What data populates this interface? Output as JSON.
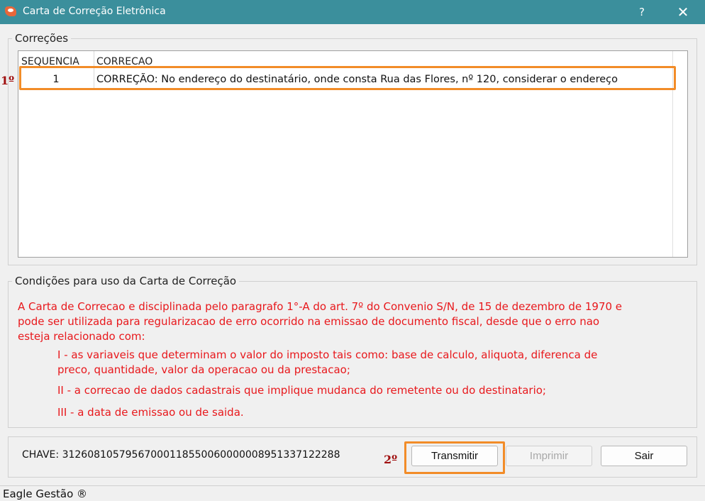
{
  "window": {
    "title": "Carta de Correção Eletrônica",
    "help": "?",
    "close": "✕"
  },
  "corrections": {
    "group_title": "Correções",
    "columns": [
      "SEQUENCIA",
      "CORRECAO"
    ],
    "rows": [
      {
        "seq": "1",
        "correcao": "CORREÇÃO: No endereço do destinatário, onde consta Rua das Flores, nº 120, considerar o endereço"
      }
    ]
  },
  "conditions": {
    "group_title": "Condições para uso da Carta de Correção",
    "intro_lines": [
      "A Carta de Correcao e disciplinada pelo paragrafo 1°-A do art. 7º do Convenio S/N, de 15 de dezembro de 1970 e",
      "pode ser utilizada para regularizacao de erro ocorrido na emissao de documento fiscal, desde que o erro nao",
      "esteja relacionado com:"
    ],
    "item1_lines": [
      "I - as variaveis que determinam o valor do imposto tais como: base de calculo, aliquota, diferenca de",
      "preco, quantidade, valor da operacao ou da prestacao;"
    ],
    "item2": "II - a correcao de dados cadastrais que implique mudanca do remetente ou do destinatario;",
    "item3": "III - a data de emissao ou de saida."
  },
  "footer": {
    "chave": "CHAVE: 31260810579567000118550060000008951337122288",
    "transmitir": "Transmitir",
    "imprimir": "Imprimir",
    "sair": "Sair"
  },
  "markers": {
    "first": "1º",
    "second": "2º"
  },
  "statusbar": {
    "text": "Eagle Gestão ®"
  },
  "colors": {
    "titlebar": "#3b8f9c",
    "highlight": "#f28c28",
    "condition_text": "#e8181c",
    "marker": "#a01010"
  }
}
